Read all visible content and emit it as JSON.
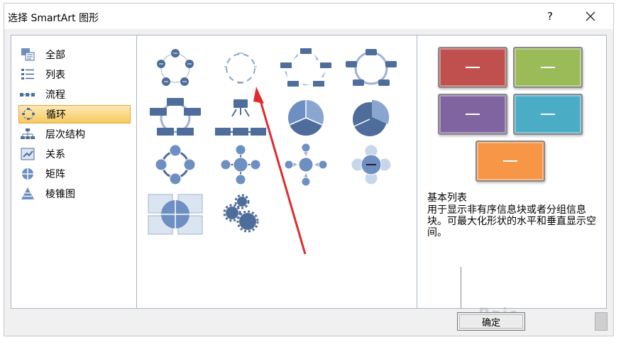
{
  "window": {
    "title": "选择 SmartArt 图形",
    "help_label": "?",
    "close_label": "×"
  },
  "categories": [
    {
      "label": "全部",
      "icon": "all-icon",
      "selected": false
    },
    {
      "label": "列表",
      "icon": "list-icon",
      "selected": false
    },
    {
      "label": "流程",
      "icon": "process-icon",
      "selected": false
    },
    {
      "label": "循环",
      "icon": "cycle-icon",
      "selected": true
    },
    {
      "label": "层次结构",
      "icon": "hierarchy-icon",
      "selected": false
    },
    {
      "label": "关系",
      "icon": "relationship-icon",
      "selected": false
    },
    {
      "label": "矩阵",
      "icon": "matrix-icon",
      "selected": false
    },
    {
      "label": "棱锥图",
      "icon": "pyramid-icon",
      "selected": false
    }
  ],
  "layouts": [
    "basic-cycle",
    "text-cycle",
    "cycle-arrows",
    "block-cycle",
    "segmented-cycle",
    "nondirectional-cycle",
    "cycle-pie",
    "cycle-pie-slice",
    "radial-cycle",
    "basic-radial",
    "diverging-radial",
    "radial-venn",
    "cycle-matrix",
    "gear"
  ],
  "preview": {
    "colors": [
      "#c0504d",
      "#9bbb59",
      "#8064a2",
      "#4bacc6",
      "#f79646"
    ],
    "title": "基本列表",
    "description": "用于显示非有序信息块或者分组信息块。可最大化形状的水平和垂直显示空间。"
  },
  "buttons": {
    "ok_label": "确定"
  },
  "watermark": "Baic"
}
